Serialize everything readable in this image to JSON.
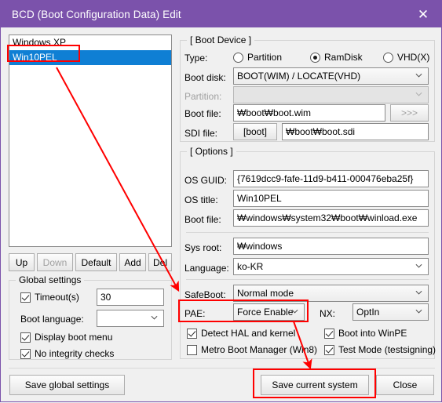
{
  "window": {
    "title": "BCD (Boot Configuration Data) Edit",
    "close_icon": "close-icon",
    "accent_color": "#7b52ab",
    "background_color": "#f0f0f0",
    "selection_color": "#0f7fd4",
    "annotation_color": "#ff0000"
  },
  "os_list": {
    "items": [
      {
        "label": "Windows XP",
        "selected": false
      },
      {
        "label": "Win10PEL",
        "selected": true
      }
    ]
  },
  "list_buttons": [
    {
      "label": "Up",
      "enabled": true
    },
    {
      "label": "Down",
      "enabled": false
    },
    {
      "label": "Default",
      "enabled": true
    },
    {
      "label": "Add",
      "enabled": true
    },
    {
      "label": "Del",
      "enabled": true
    }
  ],
  "global_settings": {
    "title": "Global settings",
    "timeout": {
      "label": "Timeout(s)",
      "checked": true,
      "value": "30"
    },
    "boot_language": {
      "label": "Boot language:",
      "value": ""
    },
    "display_boot_menu": {
      "label": "Display boot menu",
      "checked": true
    },
    "no_integrity_checks": {
      "label": "No integrity checks",
      "checked": true
    }
  },
  "boot_device": {
    "title": "[ Boot Device ]",
    "type": {
      "label": "Type:",
      "options": [
        {
          "label": "Partition",
          "selected": false
        },
        {
          "label": "RamDisk",
          "selected": true
        },
        {
          "label": "VHD(X)",
          "selected": false
        }
      ]
    },
    "boot_disk": {
      "label": "Boot disk:",
      "value": "BOOT(WIM) / LOCATE(VHD)",
      "enabled": true
    },
    "partition": {
      "label": "Partition:",
      "value": "",
      "enabled": false
    },
    "boot_file": {
      "label": "Boot file:",
      "value": "₩boot₩boot.wim",
      "browse_label": ">>>",
      "browse_enabled": false
    },
    "sdi_file": {
      "label": "SDI file:",
      "button_label": "[boot]",
      "value": "₩boot₩boot.sdi"
    }
  },
  "options": {
    "title": "[ Options ]",
    "os_guid": {
      "label": "OS GUID:",
      "value": "{7619dcc9-fafe-11d9-b411-000476eba25f}"
    },
    "os_title": {
      "label": "OS title:",
      "value": "Win10PEL"
    },
    "boot_file": {
      "label": "Boot file:",
      "value": "₩windows₩system32₩boot₩winload.exe"
    },
    "sys_root": {
      "label": "Sys root:",
      "value": "₩windows"
    },
    "language": {
      "label": "Language:",
      "value": "ko-KR"
    },
    "safeboot": {
      "label": "SafeBoot:",
      "value": "Normal mode"
    },
    "pae": {
      "label": "PAE:",
      "value": "Force Enable"
    },
    "nx": {
      "label": "NX:",
      "value": "OptIn"
    },
    "detect_hal": {
      "label": "Detect HAL and kernel",
      "checked": true
    },
    "metro_boot_manager": {
      "label": "Metro Boot Manager (Win8)",
      "checked": false
    },
    "boot_into_winpe": {
      "label": "Boot into WinPE",
      "checked": true
    },
    "test_mode": {
      "label": "Test Mode (testsigning)",
      "checked": true
    }
  },
  "footer": {
    "save_global": "Save global settings",
    "save_current": "Save current system",
    "close": "Close"
  }
}
